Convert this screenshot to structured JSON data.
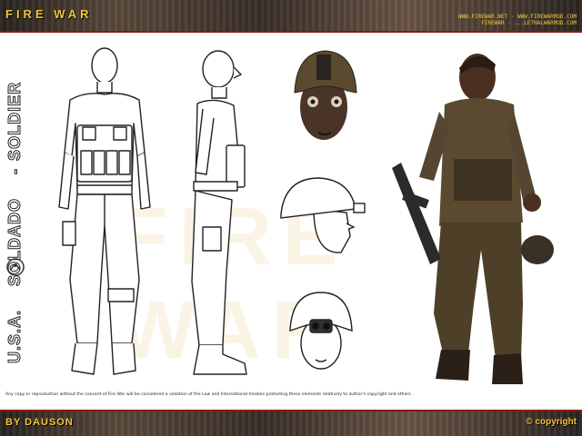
{
  "header": {
    "title": "FIRE WAR",
    "urls_line1": "WWW.FIREWAR.NET · WWW.FIREWARMOD.COM",
    "urls_line2": "FIREWAR · ...LETHALWARMOD.COM"
  },
  "sidebar": {
    "country": "U.S.A.",
    "label_pt": "SOLDADO",
    "label_en": "SOLDIER"
  },
  "watermark": "FIRE WAR",
  "legal": "Any copy or reproduction without the consent of Fire War will be considered a violation of the Law and International treaties protecting these elements relatively to author's copyright and others.",
  "footer": {
    "author": "BY DAUSON",
    "copyright": "© copyright"
  },
  "colors": {
    "accent": "#f2c33a",
    "border_red": "#8a1a12",
    "band_dark": "#2a2420",
    "uniform": "#5b4a30",
    "skin": "#6b4a36"
  }
}
